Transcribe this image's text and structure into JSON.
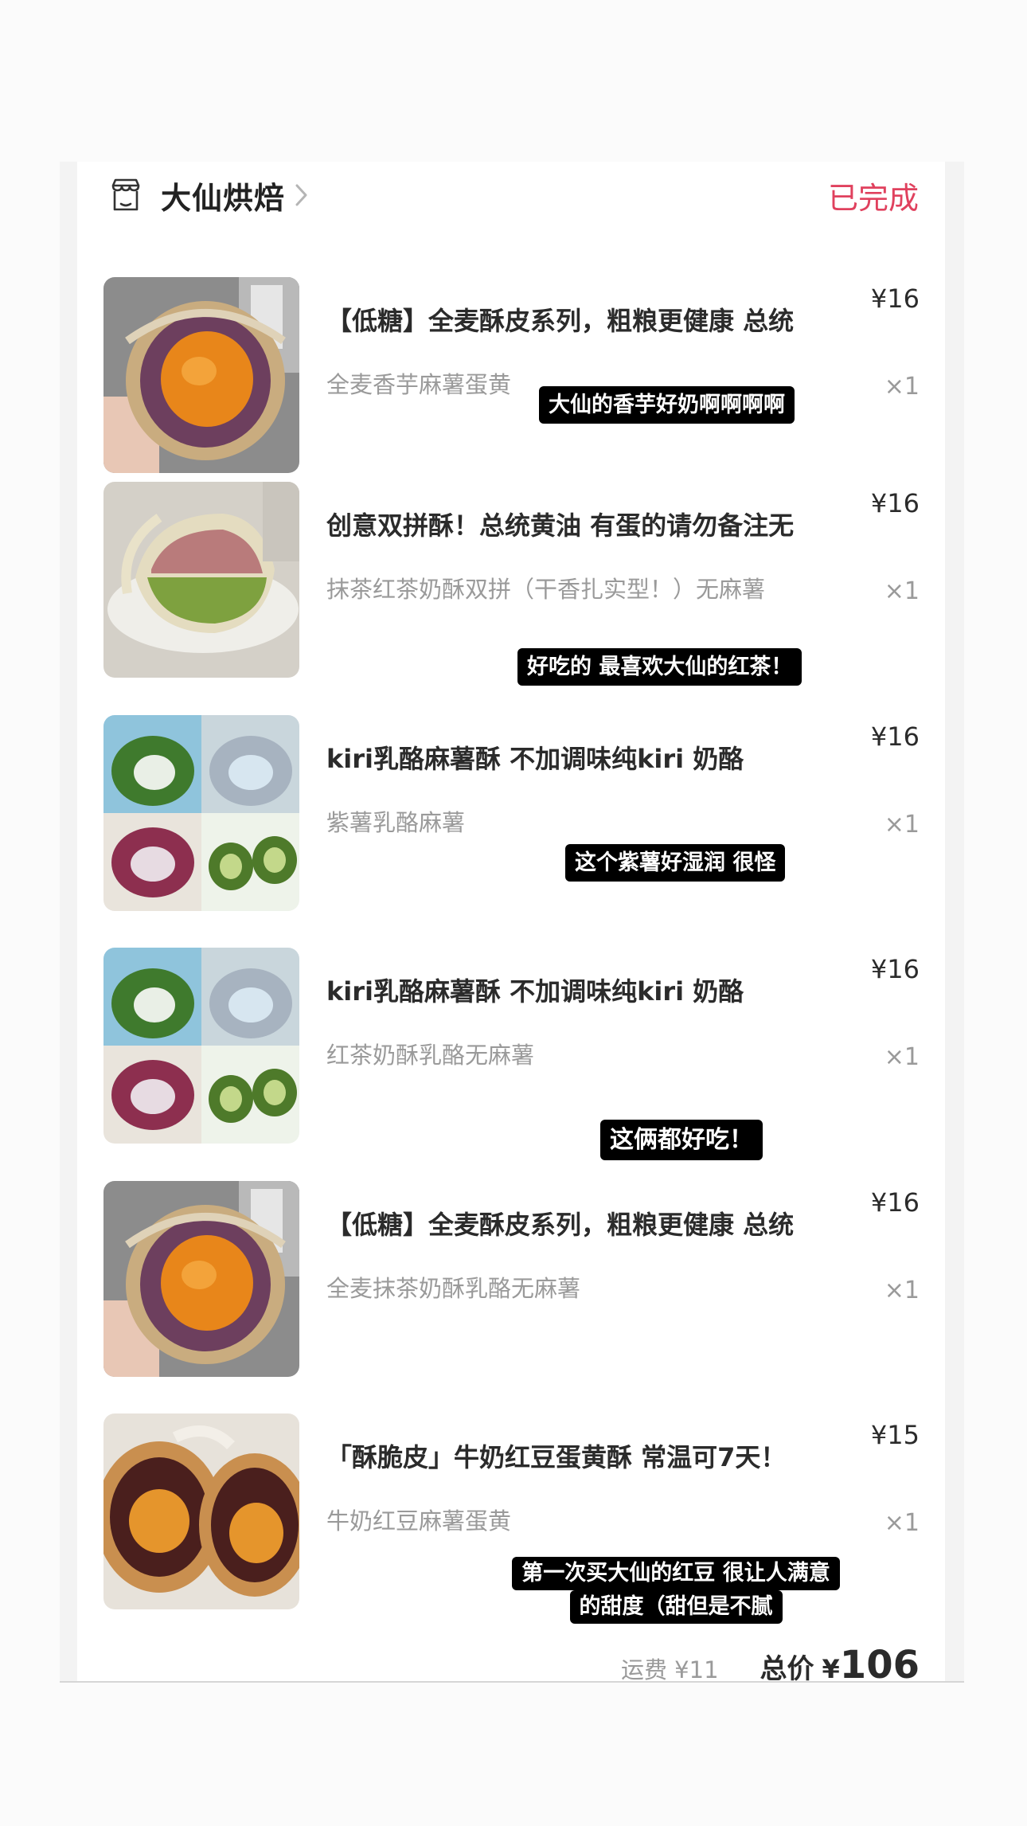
{
  "store": {
    "name": "大仙烘焙",
    "status": "已完成",
    "icon": "store-icon"
  },
  "items": [
    {
      "title": "【低糖】全麦酥皮系列，粗粮更健康 总统",
      "spec": "全麦香芋麻薯蛋黄",
      "price": "¥16",
      "qty": "×1",
      "comment": "大仙的香芋好奶啊啊啊啊",
      "image": "taro-egg-yolk-pastry"
    },
    {
      "title": "创意双拼酥！总统黄油 有蛋的请勿备注无",
      "spec": "抹茶红茶奶酥双拼（干香扎实型！）无麻薯",
      "price": "¥16",
      "qty": "×1",
      "comment": "好吃的 最喜欢大仙的红茶！",
      "image": "matcha-redtea-pastry"
    },
    {
      "title": "kiri乳酪麻薯酥 不加调味纯kiri 奶酪",
      "spec": "紫薯乳酪麻薯",
      "price": "¥16",
      "qty": "×1",
      "comment": "这个紫薯好湿润 很怪",
      "image": "kiri-cheese-pastry-collage"
    },
    {
      "title": "kiri乳酪麻薯酥 不加调味纯kiri 奶酪",
      "spec": "红茶奶酥乳酪无麻薯",
      "price": "¥16",
      "qty": "×1",
      "comment": "这俩都好吃！",
      "image": "kiri-cheese-pastry-collage"
    },
    {
      "title": "【低糖】全麦酥皮系列，粗粮更健康 总统",
      "spec": "全麦抹茶奶酥乳酪无麻薯",
      "price": "¥16",
      "qty": "×1",
      "comment": "",
      "image": "taro-egg-yolk-pastry"
    },
    {
      "title": "「酥脆皮」牛奶红豆蛋黄酥 常温可7天！",
      "spec": "牛奶红豆麻薯蛋黄",
      "price": "¥15",
      "qty": "×1",
      "comment_line1": "第一次买大仙的红豆 很让人满意",
      "comment_line2": "的甜度（甜但是不腻",
      "image": "red-bean-egg-yolk-pastry"
    }
  ],
  "footer": {
    "shipping": "运费 ¥11",
    "total_label": "总价",
    "total_currency": "¥",
    "total_value": "106"
  }
}
